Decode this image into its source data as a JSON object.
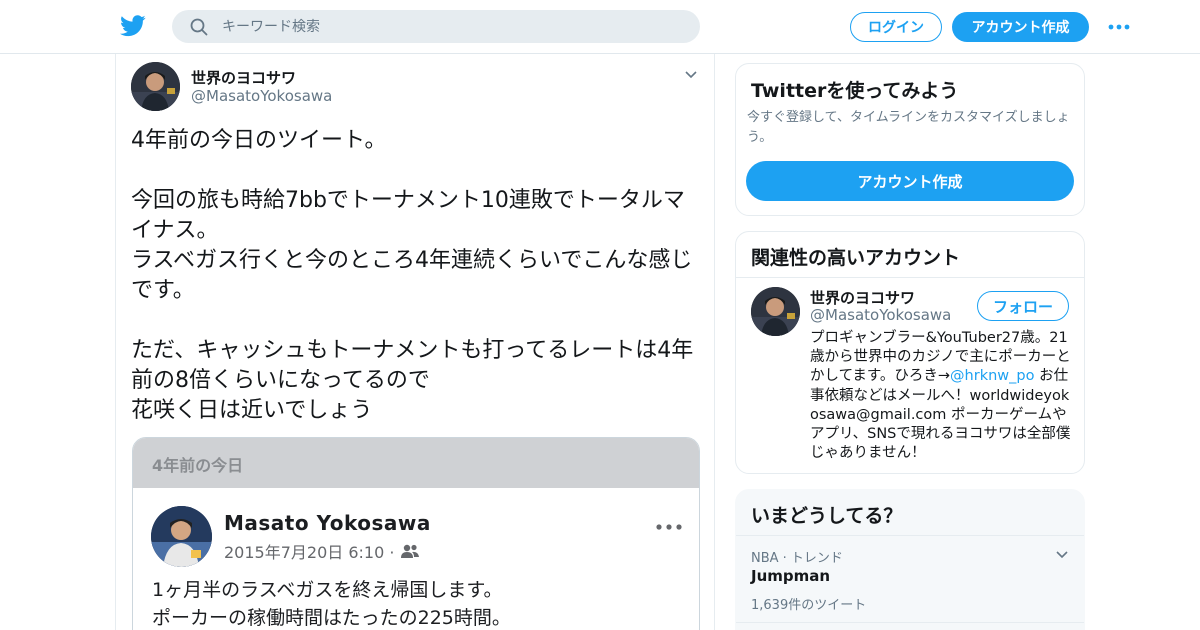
{
  "header": {
    "search_placeholder": "キーワード検索",
    "login_label": "ログイン",
    "signup_label": "アカウント作成",
    "brand_color": "#1da1f2"
  },
  "tweet": {
    "author_name": "世界のヨコサワ",
    "author_handle": "@MasatoYokosawa",
    "text": "4年前の今日のツイート。\n\n今回の旅も時給7bbでトーナメント10連敗でトータルマイナス。\nラスベガス行くと今のところ4年連続くらいでこんな感じです。\n\nただ、キャッシュもトーナメントも打ってるレートは4年前の8倍くらいになってるので\n花咲く日は近いでしょう",
    "image_card": {
      "header": "4年前の今日",
      "name": "Masato  Yokosawa",
      "date": "2015年7月20日 6:10 ·",
      "text": "1ヶ月半のラスベガスを終え帰国します。\nポーカーの稼働時間はたったの225時間。"
    }
  },
  "sidebar": {
    "signup_module": {
      "title": "Twitterを使ってみよう",
      "subtitle": "今すぐ登録して、タイムラインをカスタマイズしましょう。",
      "button": "アカウント作成"
    },
    "related": {
      "title": "関連性の高いアカウント",
      "account": {
        "name": "世界のヨコサワ",
        "handle": "@MasatoYokosawa",
        "follow_label": "フォロー",
        "bio_part1": "プロギャンブラー&YouTuber27歳。21歳から世界中のカジノで主にポーカーとかしてます。ひろき→",
        "bio_link": "@hrknw_po",
        "bio_part2": " お仕事依頼などはメールへ！worldwideyokosawa@gmail.com ポーカーゲームやアプリ、SNSで現れるヨコサワは全部僕じゃありません！"
      }
    },
    "trends": {
      "title": "いまどうしてる？",
      "items": [
        {
          "context": "NBA · トレンド",
          "name": "Jumpman",
          "count": "1,639件のツイート"
        }
      ]
    }
  }
}
